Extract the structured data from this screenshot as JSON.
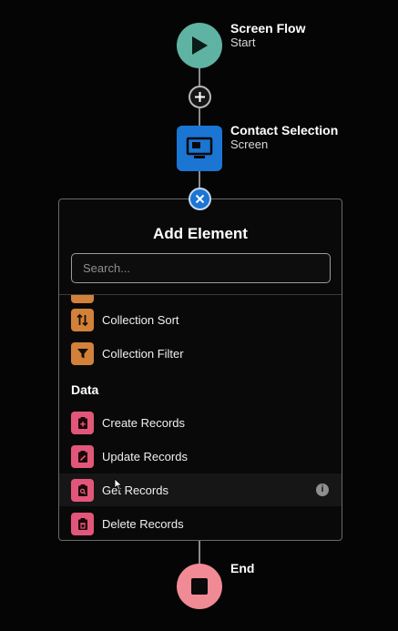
{
  "flow": {
    "start": {
      "title": "Screen Flow",
      "subtitle": "Start",
      "icon": "play-icon",
      "color": "#5fb3a3"
    },
    "screen": {
      "title": "Contact Selection",
      "subtitle": "Screen",
      "icon": "screen-icon",
      "color": "#1b75d3"
    },
    "end": {
      "title": "End",
      "icon": "stop-icon",
      "color": "#f08a94"
    }
  },
  "panel": {
    "title": "Add Element",
    "search_placeholder": "Search...",
    "search_value": "",
    "items_top": [
      {
        "label": "Collection Sort",
        "icon": "sort-arrows-icon",
        "color": "#d2813a"
      },
      {
        "label": "Collection Filter",
        "icon": "filter-icon",
        "color": "#d2813a"
      }
    ],
    "section_label": "Data",
    "data_items": [
      {
        "label": "Create Records",
        "icon": "create-records-icon",
        "color": "#e2567a"
      },
      {
        "label": "Update Records",
        "icon": "update-records-icon",
        "color": "#e2567a"
      },
      {
        "label": "Get Records",
        "icon": "get-records-icon",
        "color": "#e2567a",
        "hovered": true
      },
      {
        "label": "Delete Records",
        "icon": "delete-records-icon",
        "color": "#e2567a"
      }
    ],
    "info_glyph": "i"
  }
}
